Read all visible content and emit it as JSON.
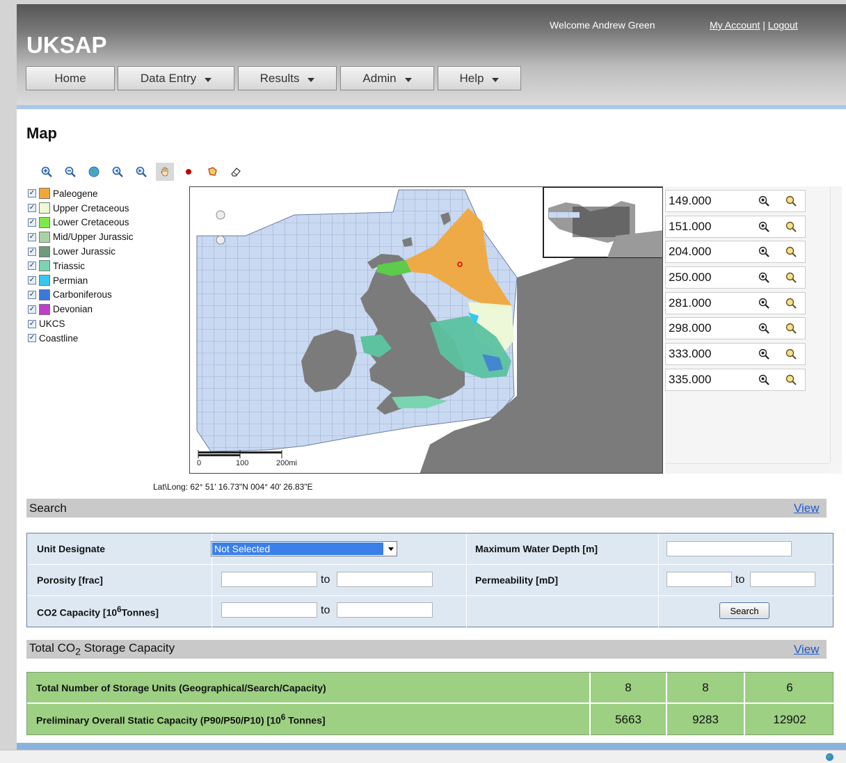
{
  "header": {
    "app_title": "UKSAP",
    "welcome": "Welcome Andrew Green",
    "my_account": "My Account",
    "separator": "|",
    "logout": "Logout"
  },
  "nav": [
    {
      "label": "Home",
      "dropdown": false
    },
    {
      "label": "Data Entry",
      "dropdown": true
    },
    {
      "label": "Results",
      "dropdown": true
    },
    {
      "label": "Admin",
      "dropdown": true
    },
    {
      "label": "Help",
      "dropdown": true
    }
  ],
  "page_title": "Map",
  "toolbar_icons": [
    "zoom-in-icon",
    "zoom-out-icon",
    "globe-icon",
    "zoom-previous-icon",
    "zoom-next-icon",
    "pan-hand-icon",
    "point-icon",
    "polygon-icon",
    "eraser-icon"
  ],
  "legend": [
    {
      "label": "Paleogene",
      "color": "#f2a63a"
    },
    {
      "label": "Upper Cretaceous",
      "color": "#eefad6"
    },
    {
      "label": "Lower Cretaceous",
      "color": "#7ee84a"
    },
    {
      "label": "Mid/Upper Jurassic",
      "color": "#a7d3a3"
    },
    {
      "label": "Lower Jurassic",
      "color": "#6e9a7b"
    },
    {
      "label": "Triassic",
      "color": "#7ad4b0"
    },
    {
      "label": "Permian",
      "color": "#37c6ee"
    },
    {
      "label": "Carboniferous",
      "color": "#3c78d8"
    },
    {
      "label": "Devonian",
      "color": "#c03ccc"
    },
    {
      "label": "UKCS",
      "color": ""
    },
    {
      "label": "Coastline",
      "color": ""
    }
  ],
  "map": {
    "scale_labels": [
      "0",
      "100",
      "200mi"
    ],
    "latlong": "Lat\\Long: 62° 51' 16.73\"N 004° 40' 26.83\"E"
  },
  "results": [
    "149.000",
    "151.000",
    "204.000",
    "250.000",
    "281.000",
    "298.000",
    "333.000",
    "335.000"
  ],
  "search": {
    "title": "Search",
    "view": "View",
    "unit_designate": "Unit Designate",
    "unit_selected": "Not Selected",
    "max_water_depth": "Maximum Water Depth [m]",
    "porosity": "Porosity [frac]",
    "permeability": "Permeability [mD]",
    "co2_capacity": "CO2 Capacity [10",
    "co2_sup": "6",
    "co2_unit": "Tonnes]",
    "to": "to",
    "search_button": "Search"
  },
  "capacity": {
    "title_pre": "Total CO",
    "title_sub": "2",
    "title_post": " Storage Capacity",
    "view": "View",
    "row1_label": "Total Number of Storage Units (Geographical/Search/Capacity)",
    "row1_values": [
      "8",
      "8",
      "6"
    ],
    "row2_label_pre": "Preliminary Overall Static Capacity (P90/P50/P10) [10",
    "row2_sup": "6",
    "row2_label_post": " Tonnes]",
    "row2_values": [
      "5663",
      "9283",
      "12902"
    ]
  },
  "colors": {
    "accent": "#a9c8ec",
    "link": "#1f59c9",
    "green": "#9dd083",
    "search_bg": "#dde8f3"
  }
}
